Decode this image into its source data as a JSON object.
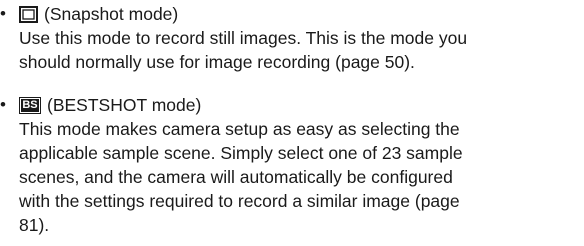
{
  "items": [
    {
      "bullet": "•",
      "icon": "snapshot-mode-icon",
      "title": "(Snapshot mode)",
      "lines": [
        "Use this mode to record still images. This is the mode you",
        "should normally use for image recording (page 50)."
      ]
    },
    {
      "bullet": "•",
      "icon": "bestshot-mode-icon",
      "icon_text": "BS",
      "title": "(BESTSHOT mode)",
      "lines": [
        "This mode makes camera setup as easy as selecting the",
        "applicable sample scene. Simply select one of 23 sample",
        "scenes, and the camera will automatically be configured",
        "with the settings required to record a similar image (page",
        "81)."
      ]
    }
  ]
}
